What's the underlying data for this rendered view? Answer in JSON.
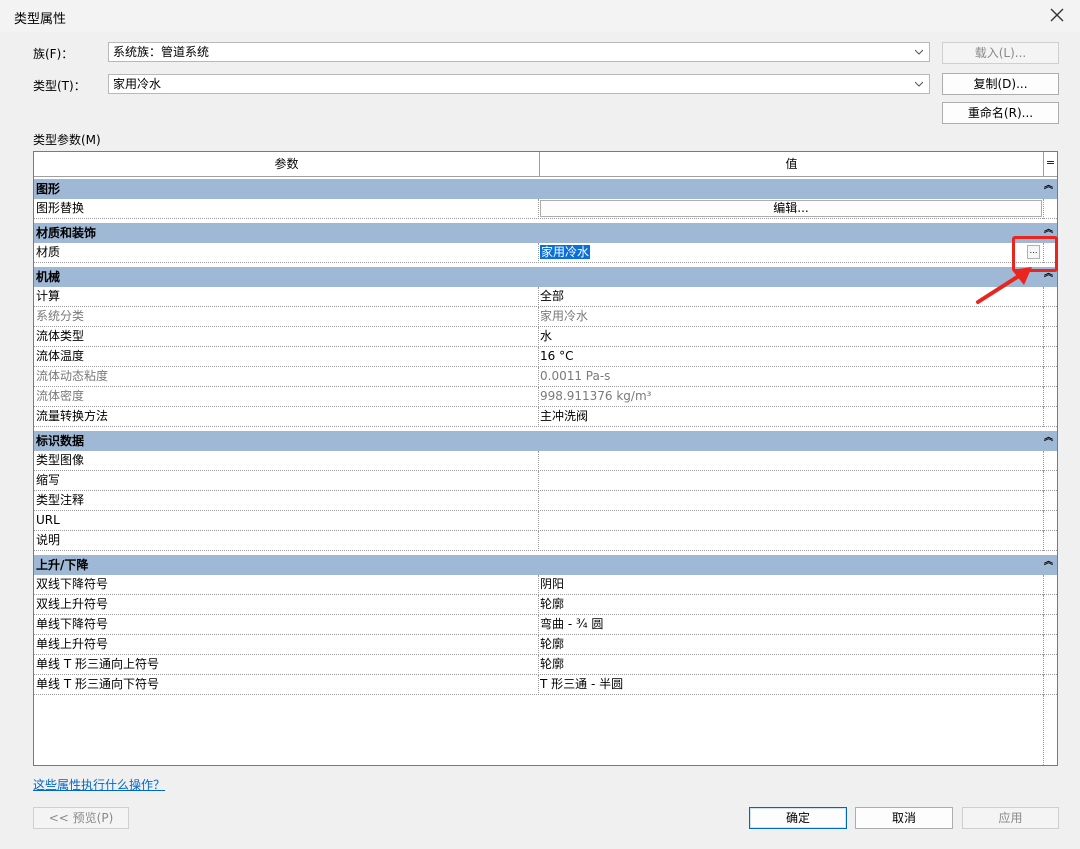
{
  "window": {
    "title": "类型属性"
  },
  "family": {
    "label": "族(F)：",
    "value": "系统族：管道系统"
  },
  "type": {
    "label": "类型(T)：",
    "value": "家用冷水"
  },
  "buttons": {
    "load": "载入(L)...",
    "duplicate": "复制(D)...",
    "rename": "重命名(R)...",
    "preview": "<< 预览(P)",
    "ok": "确定",
    "cancel": "取消",
    "apply": "应用"
  },
  "type_parameters_label": "类型参数(M)",
  "grid": {
    "header_param": "参数",
    "header_value": "值",
    "header_extra": "=",
    "groups": {
      "graphics": {
        "title": "图形",
        "rows": [
          {
            "param": "图形替换",
            "value": "编辑..."
          }
        ]
      },
      "materials": {
        "title": "材质和装饰",
        "rows": [
          {
            "param": "材质",
            "value": "家用冷水"
          }
        ]
      },
      "mechanical": {
        "title": "机械",
        "rows": [
          {
            "param": "计算",
            "value": "全部"
          },
          {
            "param": "系统分类",
            "value": "家用冷水"
          },
          {
            "param": "流体类型",
            "value": "水"
          },
          {
            "param": "流体温度",
            "value": "16 °C"
          },
          {
            "param": "流体动态粘度",
            "value": "0.0011 Pa-s"
          },
          {
            "param": "流体密度",
            "value": "998.911376 kg/m³"
          },
          {
            "param": "流量转换方法",
            "value": "主冲洗阀"
          }
        ]
      },
      "identity": {
        "title": "标识数据",
        "rows": [
          {
            "param": "类型图像",
            "value": ""
          },
          {
            "param": "缩写",
            "value": ""
          },
          {
            "param": "类型注释",
            "value": ""
          },
          {
            "param": "URL",
            "value": ""
          },
          {
            "param": "说明",
            "value": ""
          }
        ]
      },
      "rise_drop": {
        "title": "上升/下降",
        "rows": [
          {
            "param": "双线下降符号",
            "value": "阴阳"
          },
          {
            "param": "双线上升符号",
            "value": "轮廓"
          },
          {
            "param": "单线下降符号",
            "value": "弯曲 - ¾ 圆"
          },
          {
            "param": "单线上升符号",
            "value": "轮廓"
          },
          {
            "param": "单线 T 形三通向上符号",
            "value": "轮廓"
          },
          {
            "param": "单线 T 形三通向下符号",
            "value": "T 形三通 - 半圆"
          }
        ]
      }
    }
  },
  "help_link": "这些属性执行什么操作？",
  "colors": {
    "group_header": "#9fb8d6",
    "selection": "#0a6fd8",
    "annotation": "#e8261f",
    "link": "#0066cc"
  },
  "icons": {
    "close": "close-icon",
    "chevron": "chevron-down-icon",
    "collapse": "collapse-icon",
    "browse": "ellipsis-icon",
    "arrow": "red-arrow-annotation"
  }
}
